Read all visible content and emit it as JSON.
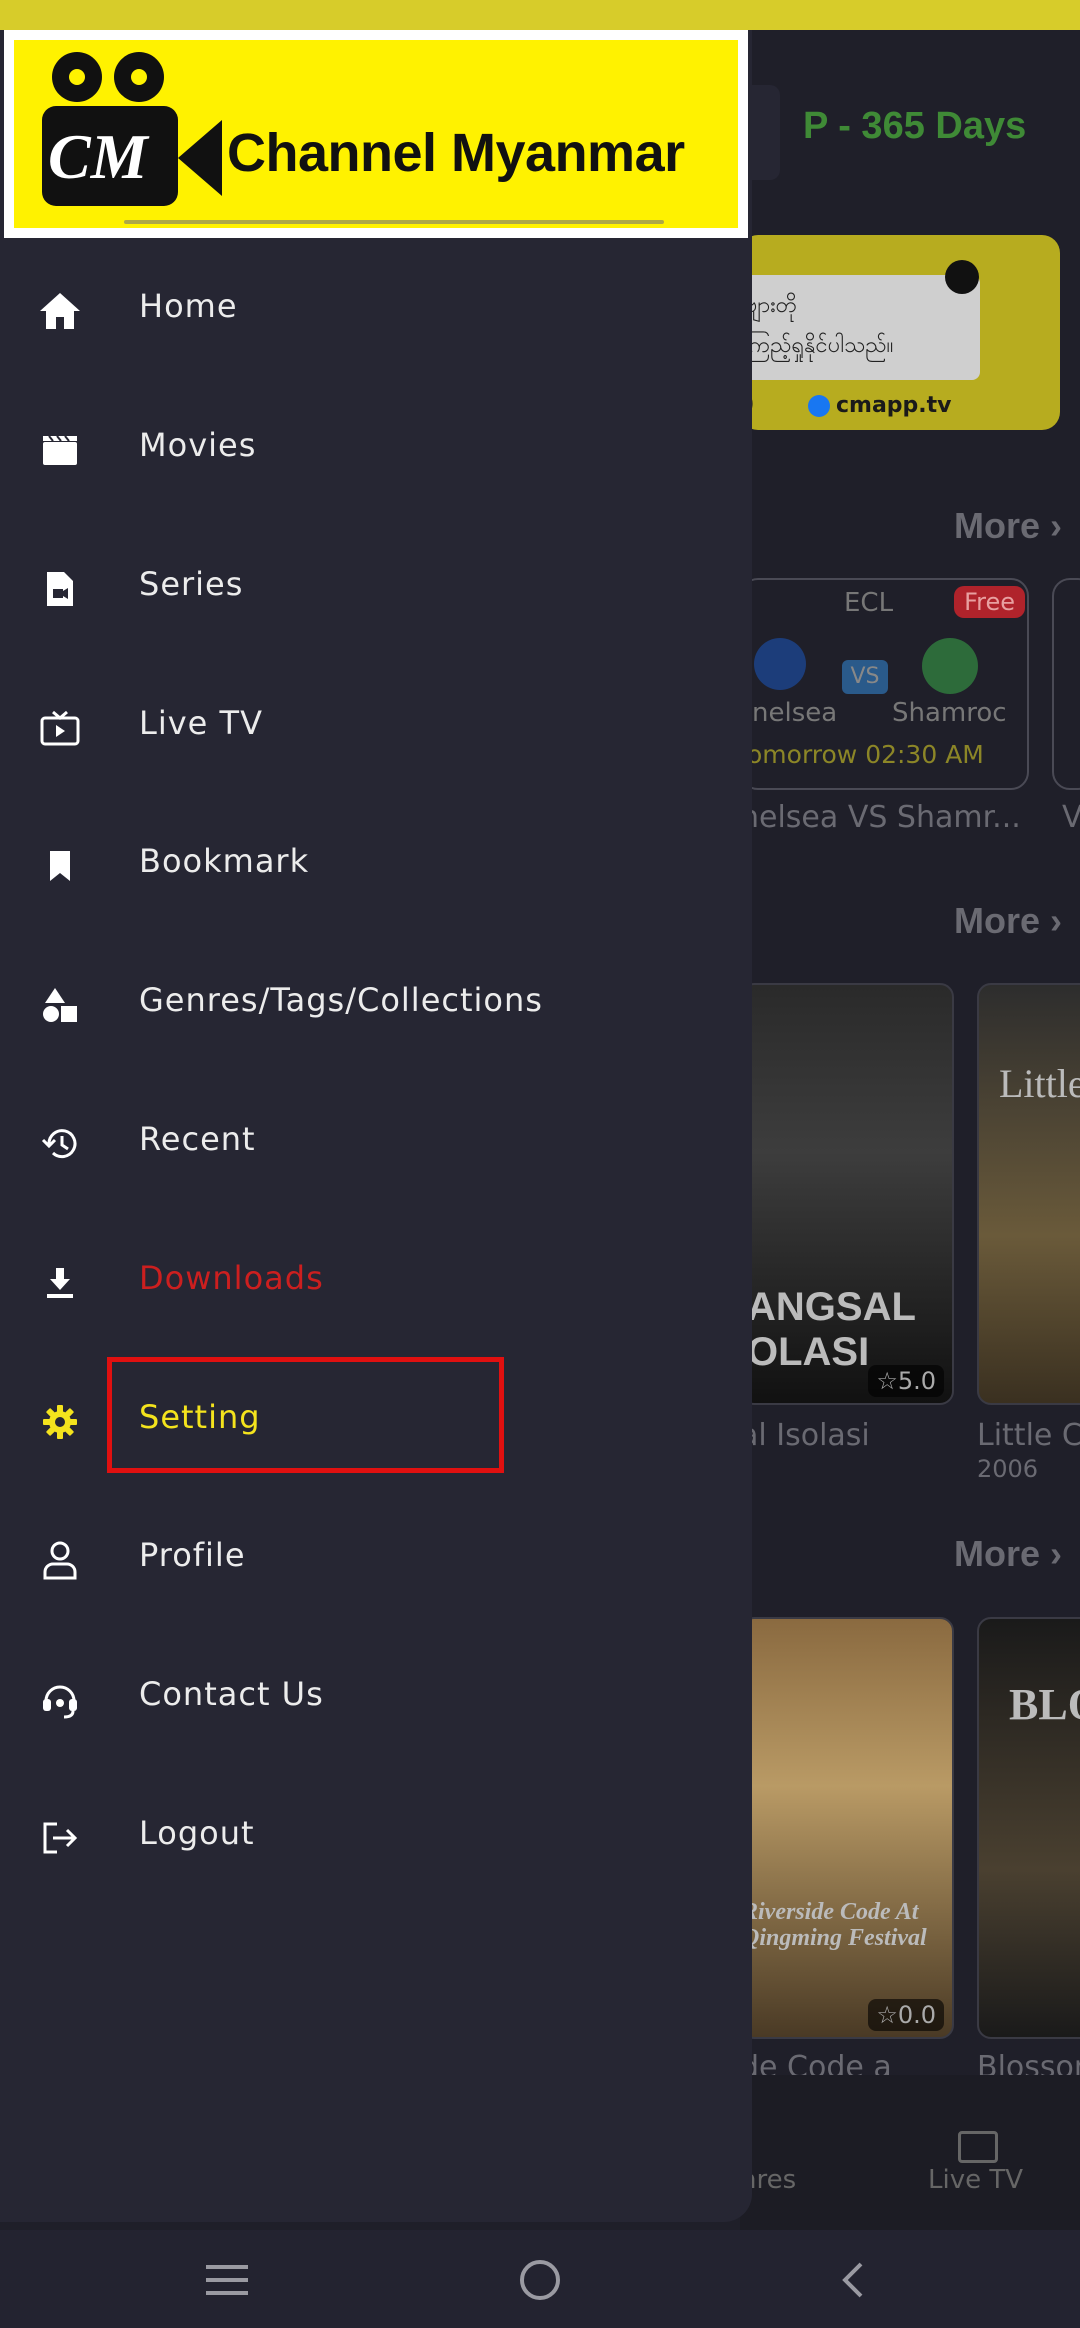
{
  "status_bar": {
    "text": ""
  },
  "background": {
    "premium_text": "P - 365 Days",
    "banner": {
      "line1": "ဗျားတို",
      "line2": "ကြည့်ရှုနိုင်ပါသည်။",
      "o_text": "0",
      "site": "cmapp.tv"
    },
    "section_more": [
      "More ›",
      "More ›",
      "More ›"
    ],
    "match": {
      "league": "ECL",
      "badge": "Free",
      "vs": "VS",
      "team1": "nelsea",
      "team2": "Shamroc",
      "time": "omorrow 02:30 AM",
      "caption": "nelsea VS Shamr...",
      "caption2": "V"
    },
    "movies_row1": [
      {
        "poster_text": "ANGSAL\nOLASI",
        "rating": "☆5.0",
        "title": "al Isolasi"
      },
      {
        "poster_text": "Little",
        "title": "Little Ch",
        "year": "2006"
      }
    ],
    "movies_row2": [
      {
        "poster_text": "Riverside Code At Qingming Festival",
        "rating": "☆0.0",
        "title": "de Code a"
      },
      {
        "poster_text": "BLO",
        "title": "Blosson"
      }
    ],
    "bottom_nav": {
      "genres": "nres",
      "live_tv": "Live TV"
    }
  },
  "drawer": {
    "logo": {
      "text": "Channel Myanmar",
      "mark": "CM"
    },
    "items": [
      {
        "label": "Home",
        "icon": "home-icon",
        "state": "normal"
      },
      {
        "label": "Movies",
        "icon": "clapperboard-icon",
        "state": "normal"
      },
      {
        "label": "Series",
        "icon": "file-video-icon",
        "state": "normal"
      },
      {
        "label": "Live TV",
        "icon": "tv-icon",
        "state": "normal"
      },
      {
        "label": "Bookmark",
        "icon": "bookmark-icon",
        "state": "normal"
      },
      {
        "label": "Genres/Tags/Collections",
        "icon": "shapes-icon",
        "state": "normal"
      },
      {
        "label": "Recent",
        "icon": "history-icon",
        "state": "normal"
      },
      {
        "label": "Downloads",
        "icon": "download-icon",
        "state": "danger"
      },
      {
        "label": "Setting",
        "icon": "gear-icon",
        "state": "active"
      },
      {
        "label": "Profile",
        "icon": "user-icon",
        "state": "normal"
      },
      {
        "label": "Contact Us",
        "icon": "headset-icon",
        "state": "normal"
      },
      {
        "label": "Logout",
        "icon": "logout-icon",
        "state": "normal"
      }
    ]
  },
  "colors": {
    "accent_yellow": "#f4e31d",
    "danger_red": "#cc1f1f",
    "drawer_bg": "#262633",
    "highlight_red": "#e01010"
  },
  "system_nav": {
    "menu": "menu-icon",
    "home": "home-circle-icon",
    "back": "back-icon"
  }
}
